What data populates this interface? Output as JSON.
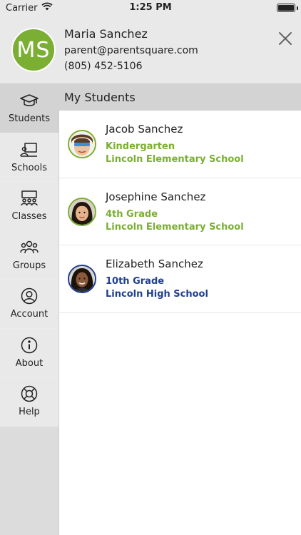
{
  "status_bar": {
    "carrier": "Carrier",
    "time": "1:25 PM",
    "battery_level": 1.0
  },
  "header": {
    "initials": "MS",
    "name": "Maria Sanchez",
    "email": "parent@parentsquare.com",
    "phone": "(805) 452-5106",
    "avatar_color": "#7aaf33",
    "close_icon": "close-icon"
  },
  "sidebar": {
    "items": [
      {
        "label": "Students",
        "icon": "graduation-cap-icon",
        "active": true
      },
      {
        "label": "Schools",
        "icon": "school-icon",
        "active": false
      },
      {
        "label": "Classes",
        "icon": "classroom-icon",
        "active": false
      },
      {
        "label": "Groups",
        "icon": "groups-icon",
        "active": false
      },
      {
        "label": "Account",
        "icon": "user-circle-icon",
        "active": false
      },
      {
        "label": "About",
        "icon": "info-icon",
        "active": false
      },
      {
        "label": "Help",
        "icon": "lifebuoy-icon",
        "active": false
      }
    ]
  },
  "main": {
    "section_title": "My Students",
    "students": [
      {
        "name": "Jacob Sanchez",
        "grade": "Kindergarten",
        "school": "Lincoln Elementary School",
        "color": "#7aaf33"
      },
      {
        "name": "Josephine Sanchez",
        "grade": "4th Grade",
        "school": "Lincoln Elementary School",
        "color": "#7aaf33"
      },
      {
        "name": "Elizabeth Sanchez",
        "grade": "10th Grade",
        "school": "Lincoln High School",
        "color": "#1f3f8f"
      }
    ]
  }
}
